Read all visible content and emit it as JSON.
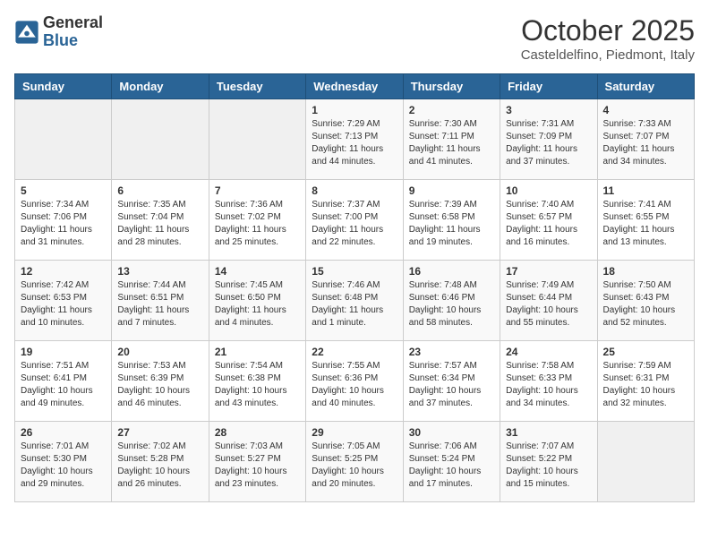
{
  "header": {
    "logo_general": "General",
    "logo_blue": "Blue",
    "month_title": "October 2025",
    "subtitle": "Casteldelfino, Piedmont, Italy"
  },
  "weekdays": [
    "Sunday",
    "Monday",
    "Tuesday",
    "Wednesday",
    "Thursday",
    "Friday",
    "Saturday"
  ],
  "weeks": [
    [
      {
        "day": "",
        "info": ""
      },
      {
        "day": "",
        "info": ""
      },
      {
        "day": "",
        "info": ""
      },
      {
        "day": "1",
        "info": "Sunrise: 7:29 AM\nSunset: 7:13 PM\nDaylight: 11 hours and 44 minutes."
      },
      {
        "day": "2",
        "info": "Sunrise: 7:30 AM\nSunset: 7:11 PM\nDaylight: 11 hours and 41 minutes."
      },
      {
        "day": "3",
        "info": "Sunrise: 7:31 AM\nSunset: 7:09 PM\nDaylight: 11 hours and 37 minutes."
      },
      {
        "day": "4",
        "info": "Sunrise: 7:33 AM\nSunset: 7:07 PM\nDaylight: 11 hours and 34 minutes."
      }
    ],
    [
      {
        "day": "5",
        "info": "Sunrise: 7:34 AM\nSunset: 7:06 PM\nDaylight: 11 hours and 31 minutes."
      },
      {
        "day": "6",
        "info": "Sunrise: 7:35 AM\nSunset: 7:04 PM\nDaylight: 11 hours and 28 minutes."
      },
      {
        "day": "7",
        "info": "Sunrise: 7:36 AM\nSunset: 7:02 PM\nDaylight: 11 hours and 25 minutes."
      },
      {
        "day": "8",
        "info": "Sunrise: 7:37 AM\nSunset: 7:00 PM\nDaylight: 11 hours and 22 minutes."
      },
      {
        "day": "9",
        "info": "Sunrise: 7:39 AM\nSunset: 6:58 PM\nDaylight: 11 hours and 19 minutes."
      },
      {
        "day": "10",
        "info": "Sunrise: 7:40 AM\nSunset: 6:57 PM\nDaylight: 11 hours and 16 minutes."
      },
      {
        "day": "11",
        "info": "Sunrise: 7:41 AM\nSunset: 6:55 PM\nDaylight: 11 hours and 13 minutes."
      }
    ],
    [
      {
        "day": "12",
        "info": "Sunrise: 7:42 AM\nSunset: 6:53 PM\nDaylight: 11 hours and 10 minutes."
      },
      {
        "day": "13",
        "info": "Sunrise: 7:44 AM\nSunset: 6:51 PM\nDaylight: 11 hours and 7 minutes."
      },
      {
        "day": "14",
        "info": "Sunrise: 7:45 AM\nSunset: 6:50 PM\nDaylight: 11 hours and 4 minutes."
      },
      {
        "day": "15",
        "info": "Sunrise: 7:46 AM\nSunset: 6:48 PM\nDaylight: 11 hours and 1 minute."
      },
      {
        "day": "16",
        "info": "Sunrise: 7:48 AM\nSunset: 6:46 PM\nDaylight: 10 hours and 58 minutes."
      },
      {
        "day": "17",
        "info": "Sunrise: 7:49 AM\nSunset: 6:44 PM\nDaylight: 10 hours and 55 minutes."
      },
      {
        "day": "18",
        "info": "Sunrise: 7:50 AM\nSunset: 6:43 PM\nDaylight: 10 hours and 52 minutes."
      }
    ],
    [
      {
        "day": "19",
        "info": "Sunrise: 7:51 AM\nSunset: 6:41 PM\nDaylight: 10 hours and 49 minutes."
      },
      {
        "day": "20",
        "info": "Sunrise: 7:53 AM\nSunset: 6:39 PM\nDaylight: 10 hours and 46 minutes."
      },
      {
        "day": "21",
        "info": "Sunrise: 7:54 AM\nSunset: 6:38 PM\nDaylight: 10 hours and 43 minutes."
      },
      {
        "day": "22",
        "info": "Sunrise: 7:55 AM\nSunset: 6:36 PM\nDaylight: 10 hours and 40 minutes."
      },
      {
        "day": "23",
        "info": "Sunrise: 7:57 AM\nSunset: 6:34 PM\nDaylight: 10 hours and 37 minutes."
      },
      {
        "day": "24",
        "info": "Sunrise: 7:58 AM\nSunset: 6:33 PM\nDaylight: 10 hours and 34 minutes."
      },
      {
        "day": "25",
        "info": "Sunrise: 7:59 AM\nSunset: 6:31 PM\nDaylight: 10 hours and 32 minutes."
      }
    ],
    [
      {
        "day": "26",
        "info": "Sunrise: 7:01 AM\nSunset: 5:30 PM\nDaylight: 10 hours and 29 minutes."
      },
      {
        "day": "27",
        "info": "Sunrise: 7:02 AM\nSunset: 5:28 PM\nDaylight: 10 hours and 26 minutes."
      },
      {
        "day": "28",
        "info": "Sunrise: 7:03 AM\nSunset: 5:27 PM\nDaylight: 10 hours and 23 minutes."
      },
      {
        "day": "29",
        "info": "Sunrise: 7:05 AM\nSunset: 5:25 PM\nDaylight: 10 hours and 20 minutes."
      },
      {
        "day": "30",
        "info": "Sunrise: 7:06 AM\nSunset: 5:24 PM\nDaylight: 10 hours and 17 minutes."
      },
      {
        "day": "31",
        "info": "Sunrise: 7:07 AM\nSunset: 5:22 PM\nDaylight: 10 hours and 15 minutes."
      },
      {
        "day": "",
        "info": ""
      }
    ]
  ]
}
